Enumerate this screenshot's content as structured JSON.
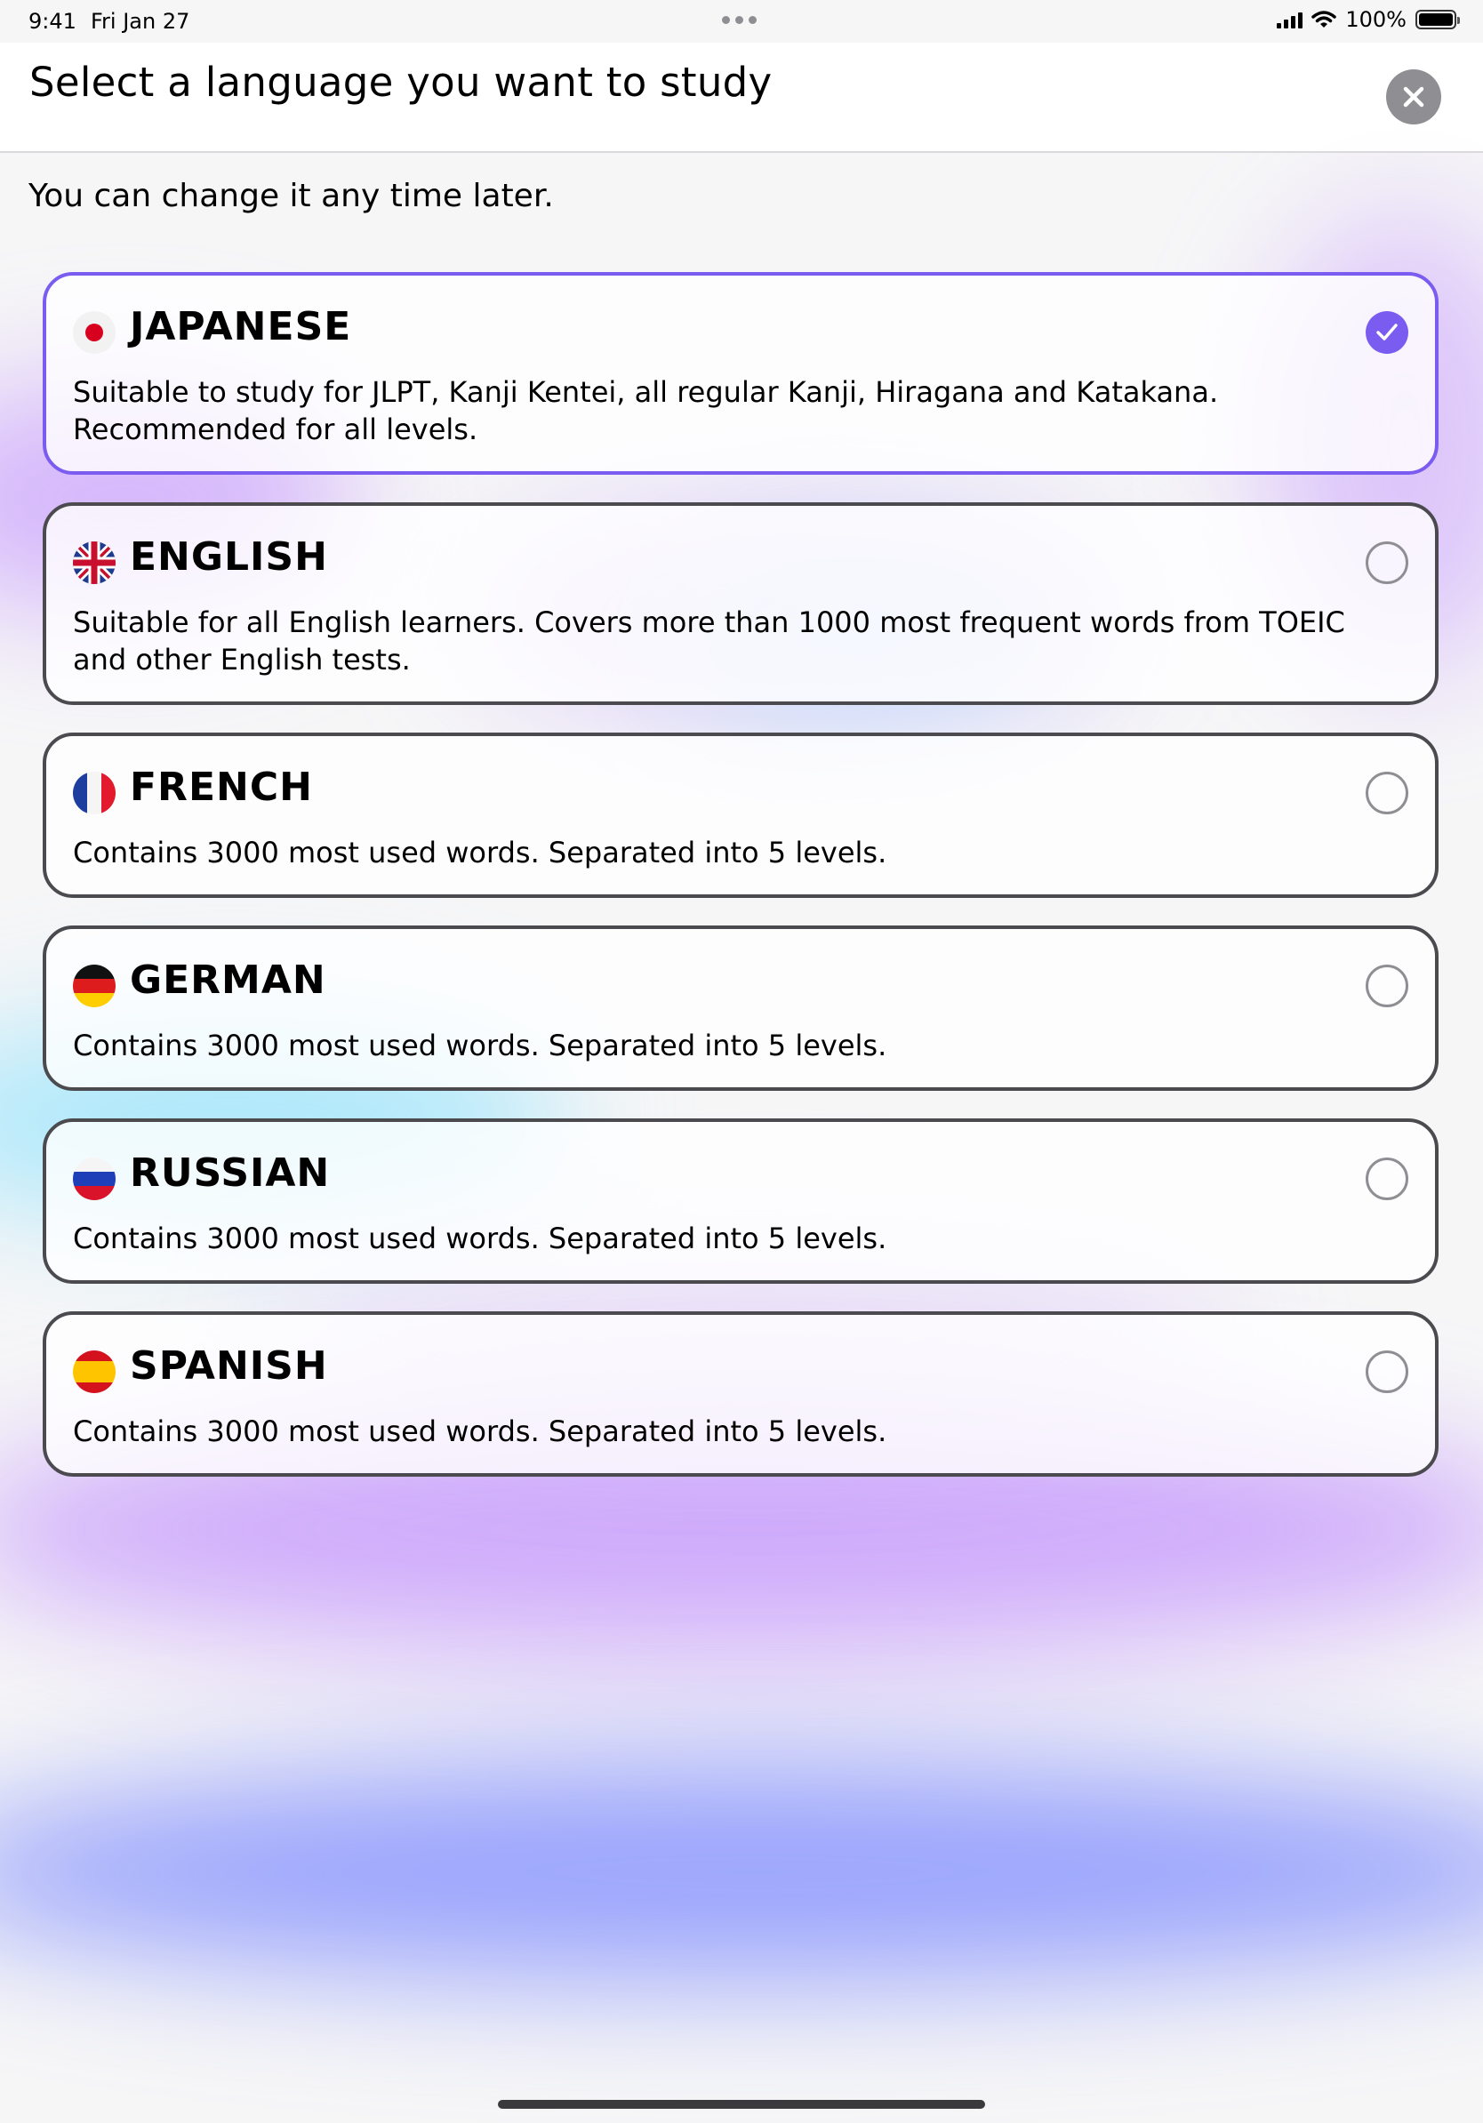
{
  "status_bar": {
    "time": "9:41",
    "date": "Fri Jan 27",
    "battery": "100%"
  },
  "header": {
    "title": "Select a language you want to study",
    "close_icon": "close-icon"
  },
  "subtitle": "You can change it any time later.",
  "languages": [
    {
      "name": "JAPANESE",
      "flag": "japan-flag-icon",
      "description": "Suitable to study for JLPT, Kanji Kentei, all regular Kanji, Hiragana and Katakana. Recommended for all levels.",
      "selected": true
    },
    {
      "name": "ENGLISH",
      "flag": "uk-flag-icon",
      "description": "Suitable for all English learners. Covers more than 1000 most frequent words from TOEIC and other English tests.",
      "selected": false
    },
    {
      "name": "FRENCH",
      "flag": "france-flag-icon",
      "description": "Contains 3000 most used words. Separated into 5 levels.",
      "selected": false
    },
    {
      "name": "GERMAN",
      "flag": "germany-flag-icon",
      "description": "Contains 3000 most used words. Separated into 5 levels.",
      "selected": false
    },
    {
      "name": "RUSSIAN",
      "flag": "russia-flag-icon",
      "description": "Contains 3000 most used words. Separated into 5 levels.",
      "selected": false
    },
    {
      "name": "SPANISH",
      "flag": "spain-flag-icon",
      "description": "Contains 3000 most used words. Separated into 5 levels.",
      "selected": false
    }
  ],
  "colors": {
    "accent": "#7a5cf0",
    "card_border": "#4a4a4f",
    "close_button": "#8e8e93"
  }
}
